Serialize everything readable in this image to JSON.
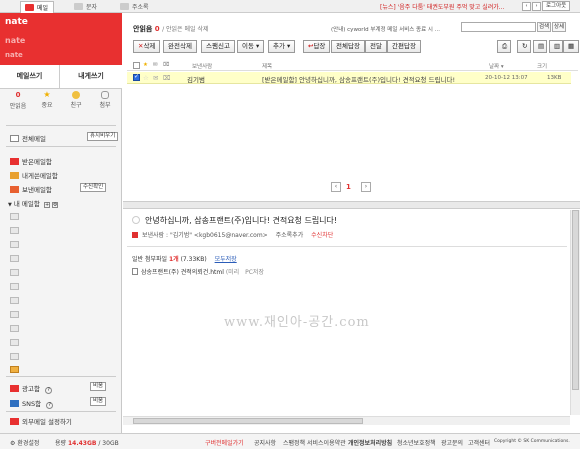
{
  "topbar": {
    "tabs": [
      {
        "label": "메일",
        "active": true,
        "icon": "mail-icon"
      },
      {
        "label": "문자",
        "active": false,
        "icon": "sms-icon"
      },
      {
        "label": "주소록",
        "active": false,
        "icon": "addressbook-icon"
      }
    ],
    "notice": "[뉴스] '음주 다툼' 태권도부원 주먹 맞고 실려가...",
    "logout_label": "로그아웃",
    "colors": {
      "brand": "#e83030"
    }
  },
  "sidebar": {
    "logo": "nate",
    "logo_sub": "nate",
    "logo_sub2": "nate",
    "compose_label": "메일쓰기",
    "self_compose_label": "내게쓰기",
    "stats": [
      {
        "count": "0",
        "label": "안읽음",
        "icon": "unread-icon"
      },
      {
        "count": "",
        "label": "중요",
        "icon": "star-icon"
      },
      {
        "count": "",
        "label": "친구",
        "icon": "friend-icon"
      },
      {
        "count": "",
        "label": "첨부",
        "icon": "attachment-icon"
      }
    ],
    "all_mail_label": "전체메일",
    "empty_trash_label": "휴지비우기",
    "folders": [
      {
        "label": "받은메일함",
        "icon": "inbox-icon"
      },
      {
        "label": "내게쓴메일함",
        "icon": "self-mail-icon"
      },
      {
        "label": "보낸메일함",
        "icon": "sent-icon",
        "action": "수신확인"
      }
    ],
    "my_folder_label": "내 메일함",
    "spam_label": "광고함",
    "sns_label": "SNS함",
    "empty_label": "비움",
    "external_settings_label": "외부메일 설정하기"
  },
  "main": {
    "title": "안읽음",
    "unread_count": "0",
    "title_suffix": "/ 안읽은 메일 삭제",
    "promo": "(안내) cyworld 부계정 메일 서비스 종료 시 ...",
    "search_button": "검색",
    "detail_button": "상세",
    "toolbar": [
      {
        "label": "삭제",
        "icon": "delete-icon"
      },
      {
        "label": "완전삭제"
      },
      {
        "label": "스팸신고"
      },
      {
        "label": "이동 ▾"
      },
      {
        "label": "추가 ▾"
      },
      {
        "label": "답장",
        "icon": "reply-icon"
      },
      {
        "label": "전체답장"
      },
      {
        "label": "전달"
      },
      {
        "label": "간편답장"
      }
    ],
    "columns": {
      "sender": "보낸사람",
      "subject": "제목",
      "date": "날짜 ▾",
      "size": "크기"
    },
    "rows": [
      {
        "checked": true,
        "sender": "김기범",
        "subject": "[받은메일함] 안녕하십니까, 삼송프랜트(주)입니다! 견적요청 드립니다!",
        "date": "20-10-12 13:07",
        "size": "13KB"
      }
    ],
    "pagination": {
      "current": "1"
    },
    "reader": {
      "subject": "안녕하십니까, 삼송프랜트(주)입니다! 견적요청 드립니다!",
      "sender_label": "보낸사람 :",
      "sender": "\"김기범\" <kgb0615@naver.com>",
      "add_contact": "주소록추가",
      "block": "수신차단",
      "attach_title": "일반 첨부파일",
      "attach_count": "1개",
      "attach_size": "(7.33KB)",
      "download_all": "모두저장",
      "file_name": "삼송프랜트(주) 견적의뢰건.html",
      "file_preview": "(미리",
      "file_save": "PC저장",
      "watermark": "www.재인아-공간.com"
    }
  },
  "status": {
    "settings": "환경설정",
    "usage_label": "용량",
    "usage_value": "14.43GB",
    "usage_total": "/ 30GB",
    "links": [
      "구버전메일가기",
      "공지사항",
      "스팸정책",
      "서비스이용약관",
      "개인정보처리방침",
      "청소년보호정책",
      "광고문의",
      "고객센터"
    ],
    "copyright": "Copyright © SK Communications."
  }
}
